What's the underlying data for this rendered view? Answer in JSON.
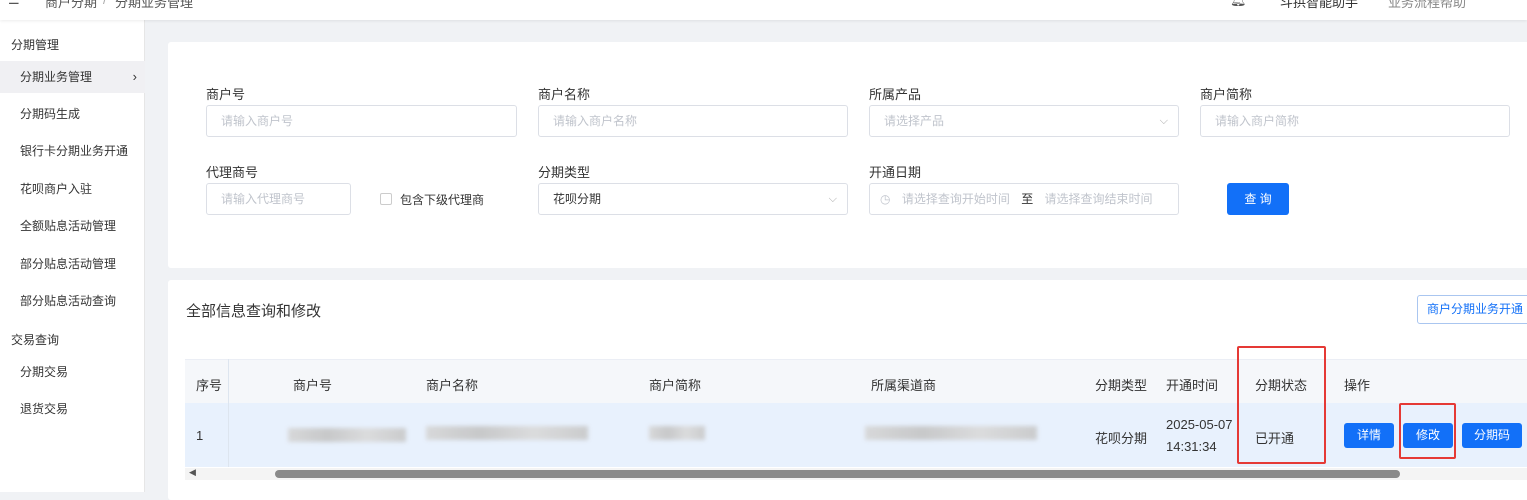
{
  "header": {
    "breadcrumb": [
      "商户分期",
      "分期业务管理"
    ],
    "separator": "/",
    "assistant": "斗拱智能助手",
    "help": "业务流程帮助"
  },
  "sidebar": {
    "groups": [
      {
        "label": "分期管理",
        "items": [
          "分期业务管理",
          "分期码生成",
          "银行卡分期业务开通",
          "花呗商户入驻",
          "全额贴息活动管理",
          "部分贴息活动管理",
          "部分贴息活动查询"
        ]
      },
      {
        "label": "交易查询",
        "items": [
          "分期交易",
          "退货交易"
        ]
      }
    ],
    "active": "分期业务管理"
  },
  "filters": {
    "merchant_no": {
      "label": "商户号",
      "placeholder": "请输入商户号"
    },
    "merchant_name": {
      "label": "商户名称",
      "placeholder": "请输入商户名称"
    },
    "product": {
      "label": "所属产品",
      "placeholder": "请选择产品"
    },
    "merchant_short": {
      "label": "商户简称",
      "placeholder": "请输入商户简称"
    },
    "agent_no": {
      "label": "代理商号",
      "placeholder": "请输入代理商号"
    },
    "include_sub": {
      "label": "包含下级代理商",
      "checked": false
    },
    "type": {
      "label": "分期类型",
      "value": "花呗分期"
    },
    "date": {
      "label": "开通日期",
      "start_placeholder": "请选择查询开始时间",
      "sep": "至",
      "end_placeholder": "请选择查询结束时间"
    },
    "query_btn": "查 询"
  },
  "table_card": {
    "title": "全部信息查询和修改",
    "open_btn": "商户分期业务开通",
    "columns": [
      "序号",
      "商户号",
      "商户名称",
      "商户简称",
      "所属渠道商",
      "分期类型",
      "开通时间",
      "分期状态",
      "操作"
    ],
    "rows": [
      {
        "idx": "1",
        "type": "花呗分期",
        "date": "2025-05-07",
        "time": "14:31:34",
        "status": "已开通",
        "actions": [
          "详情",
          "修改",
          "分期码"
        ]
      }
    ]
  }
}
